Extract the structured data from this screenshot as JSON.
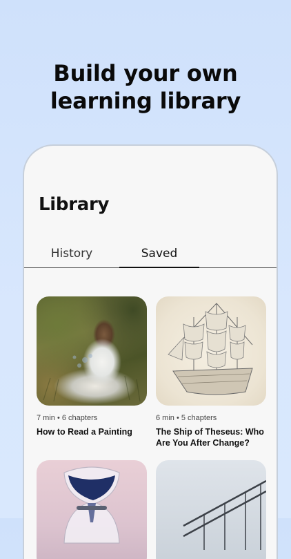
{
  "promo": {
    "line1": "Build your own",
    "line2": "learning library"
  },
  "screen": {
    "title": "Library",
    "tabs": [
      {
        "label": "History",
        "active": false
      },
      {
        "label": "Saved",
        "active": true
      }
    ],
    "cards": [
      {
        "meta": "7 min • 6 chapters",
        "title": "How to Read a Painting",
        "image": "girl-in-meadow-painting"
      },
      {
        "meta": "6 min • 5 chapters",
        "title": "The Ship of Theseus: Who Are You After Change?",
        "image": "sailing-ship-sketch"
      },
      {
        "meta": "",
        "title": "",
        "image": "hourglass"
      },
      {
        "meta": "",
        "title": "",
        "image": "staircase-railing"
      }
    ]
  },
  "colors": {
    "background": "#d5e5fc",
    "screen": "#f7f7f7",
    "text": "#111111"
  }
}
